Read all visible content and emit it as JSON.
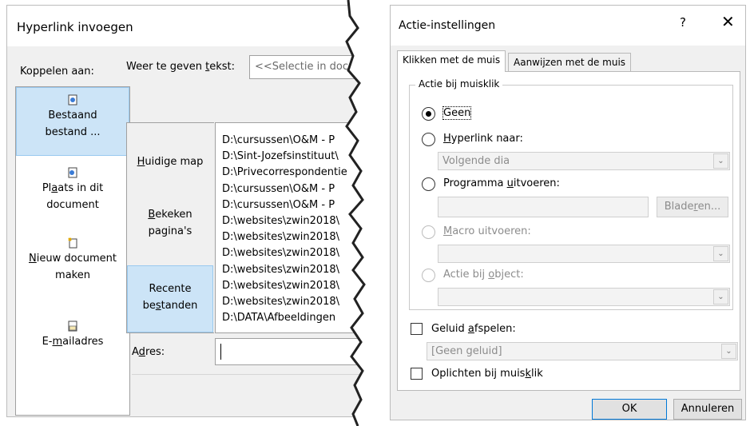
{
  "hyperlink_dialog": {
    "title": "Hyperlink invoegen",
    "link_to_label": "Koppelen aan:",
    "nav": [
      {
        "l1": "Bestaand",
        "l2": "bestand ...",
        "icon": "existing-file-icon"
      },
      {
        "l1a": "Pl",
        "l1u": "a",
        "l1b": "ats in dit",
        "l2": "document",
        "icon": "place-in-document-icon"
      },
      {
        "l1u": "N",
        "l1b": "ieuw document",
        "l2": "maken",
        "icon": "new-document-icon"
      },
      {
        "l1a": "E-",
        "l1u": "m",
        "l1b": "ailadres",
        "icon": "email-address-icon"
      }
    ],
    "text_label_a": "Weer te geven ",
    "text_label_u": "t",
    "text_label_b": "ekst:",
    "text_value": "<<Selectie in document>>",
    "look_in": [
      {
        "a": "",
        "u": "H",
        "b": "uidige map"
      },
      {
        "a": "",
        "u": "B",
        "b": "ekeken",
        "l2": "pagina's"
      },
      {
        "l1": "Recente",
        "a": "be",
        "u": "s",
        "b": "tanden"
      }
    ],
    "files": [
      "D:\\cursussen\\O&M - P",
      "D:\\Sint-Jozefsinstituut\\",
      "D:\\Privecorrespondentie",
      "D:\\cursussen\\O&M - P",
      "D:\\cursussen\\O&M - P",
      "D:\\websites\\zwin2018\\",
      "D:\\websites\\zwin2018\\",
      "D:\\websites\\zwin2018\\",
      "D:\\websites\\zwin2018\\",
      "D:\\websites\\zwin2018\\",
      "D:\\websites\\zwin2018\\",
      "D:\\DATA\\Afbeeldingen"
    ],
    "address_label_a": "A",
    "address_label_u": "d",
    "address_label_b": "res:",
    "address_value": ""
  },
  "action_dialog": {
    "title": "Actie-instellingen",
    "help": "?",
    "close": "✕",
    "tabs": [
      "Klikken met de muis",
      "Aanwijzen met de muis"
    ],
    "group_label": "Actie bij muisklik",
    "options": {
      "none": "Geen",
      "hyperlink_a": "",
      "hyperlink_u": "H",
      "hyperlink_b": "yperlink naar:",
      "hyperlink_value": "Volgende dia",
      "program_a": "Programma ",
      "program_u": "u",
      "program_b": "itvoeren:",
      "browse_a": "Blade",
      "browse_u": "r",
      "browse_b": "en...",
      "macro_a": "",
      "macro_u": "M",
      "macro_b": "acro uitvoeren:",
      "object_a": "Actie bij ",
      "object_u": "o",
      "object_b": "bject:"
    },
    "sound_a": "Geluid ",
    "sound_u": "a",
    "sound_b": "fspelen:",
    "sound_value": "[Geen geluid]",
    "highlight_a": "Oplichten bij muis",
    "highlight_u": "k",
    "highlight_b": "lik",
    "ok": "OK",
    "cancel": "Annuleren"
  }
}
